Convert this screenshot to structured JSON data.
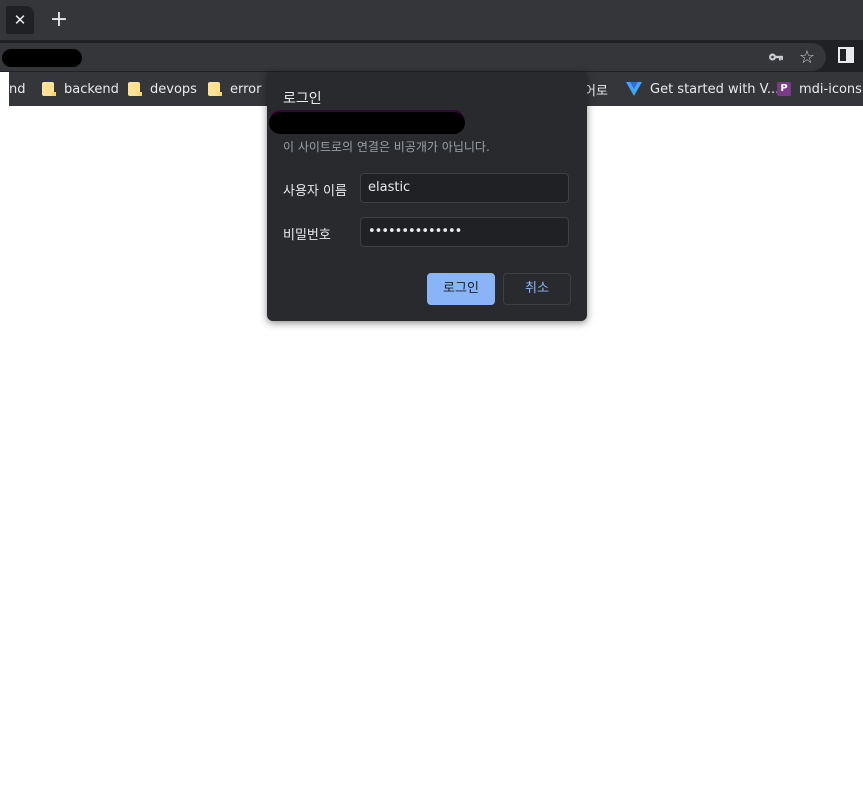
{
  "tab": {
    "close_glyph": "✕",
    "new_tab_glyph": "+"
  },
  "toolbar": {
    "icons": [
      "key-icon",
      "star-icon",
      "side-panel-icon"
    ],
    "star_glyph": "☆"
  },
  "bookmarks": [
    {
      "label": "nd",
      "icon": "none"
    },
    {
      "label": "backend",
      "icon": "folder-icon"
    },
    {
      "label": "devops",
      "icon": "folder-icon"
    },
    {
      "label": "error",
      "icon": "folder-icon"
    },
    {
      "label": "어로",
      "icon": "none"
    },
    {
      "label": "Get started with V...",
      "icon": "vite-icon"
    },
    {
      "label": "mdi-icons",
      "icon": "p-icon",
      "icon_letter": "P"
    }
  ],
  "dialog": {
    "title": "로그인",
    "description": "이 사이트로의 연결은 비공개가 아닙니다.",
    "username_label": "사용자 이름",
    "username_value": "elastic",
    "password_label": "비밀번호",
    "password_value": "••••••••••••••",
    "login_button": "로그인",
    "cancel_button": "취소"
  },
  "colors": {
    "tabstrip": "#35363a",
    "toolbar": "#202124",
    "dialog_bg": "#292a2d",
    "accent": "#8ab4f8",
    "folder": "#fde293"
  }
}
